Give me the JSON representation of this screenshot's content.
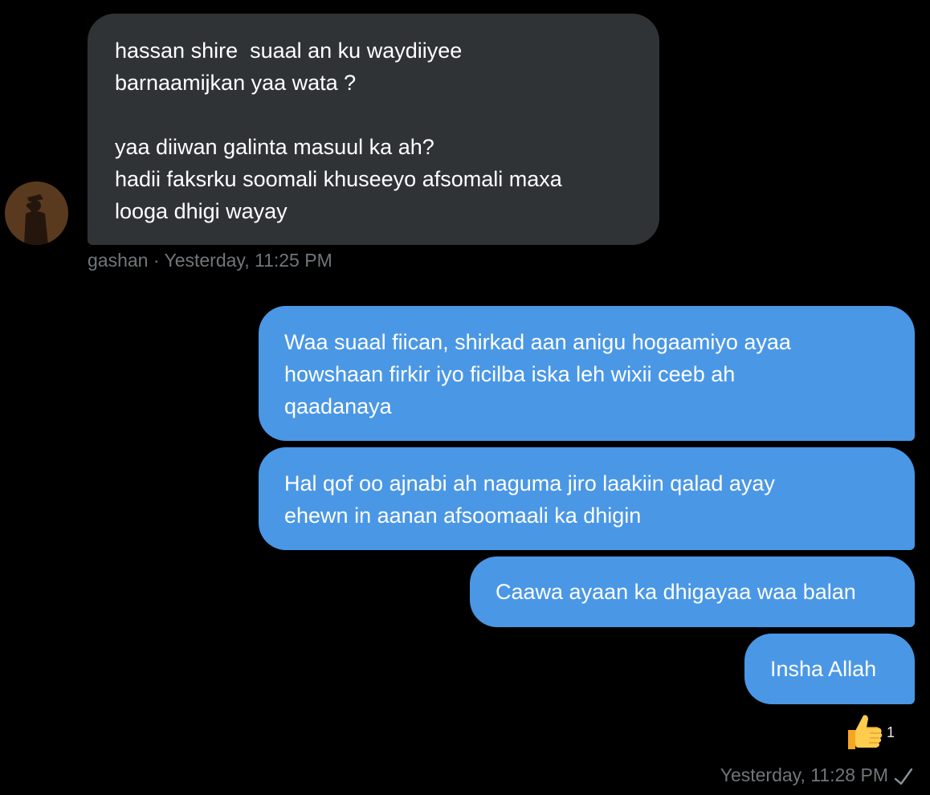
{
  "incoming": {
    "avatar_icon": "saluting-soldier-avatar",
    "text": "hassan shire  suaal an ku waydiiyee\nbarnaamijkan yaa wata ?\n\nyaa diiwan galinta masuul ka ah?\nhadii faksrku soomali khuseeyo afsomali maxa\nlooga dhigi wayay",
    "meta": "gashan · Yesterday, 11:25 PM"
  },
  "outgoing": [
    {
      "text": "Waa suaal fiican, shirkad aan anigu hogaamiyo ayaa\nhowshaan firkir iyo ficilba iska leh wixii ceeb ah\nqaadanaya"
    },
    {
      "text": "Hal qof oo ajnabi ah naguma jiro laakiin qalad ayay\nehewn in aanan afsoomaali ka dhigin"
    },
    {
      "text": "Caawa ayaan ka dhigayaa waa balan"
    },
    {
      "text": "Insha Allah"
    }
  ],
  "reaction": {
    "icon": "thumbs-up-emoji",
    "count": "1"
  },
  "meta_out": "Yesterday, 11:28 PM",
  "colors": {
    "incoming_bubble": "#2f3336",
    "outgoing_bubble": "#4a97e6",
    "meta_text": "#71767b",
    "background": "#000000"
  }
}
